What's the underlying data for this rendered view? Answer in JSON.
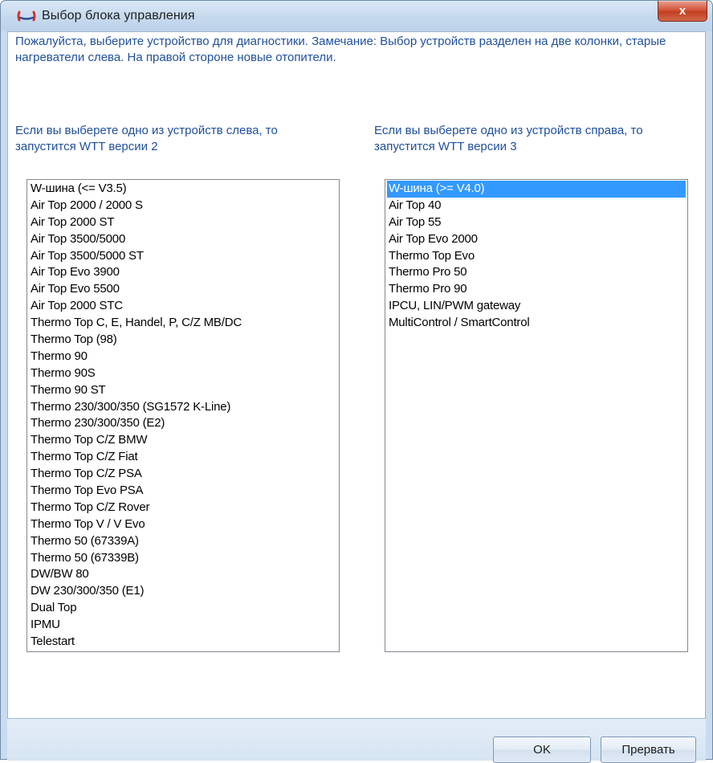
{
  "window": {
    "title": "Выбор блока управления",
    "close_label": "x"
  },
  "intro_text": "Пожалуйста, выберите устройство для диагностики. Замечание: Выбор устройств разделен на две колонки, старые нагреватели слева. На правой стороне новые отопители.",
  "left_column": {
    "hint": "Если вы выберете одно из устройств слева, то запустится WTT версии 2",
    "items": [
      "W-шина (<= V3.5)",
      "Air Top 2000 / 2000 S",
      "Air Top 2000 ST",
      "Air Top 3500/5000",
      "Air Top 3500/5000 ST",
      "Air Top Evo 3900",
      "Air Top Evo 5500",
      "Air Top 2000 STC",
      "Thermo Top C, E, Handel, P, C/Z MB/DC",
      "Thermo Top (98)",
      "Thermo 90",
      "Thermo 90S",
      "Thermo 90 ST",
      "Thermo 230/300/350 (SG1572 K-Line)",
      "Thermo 230/300/350 (E2)",
      "Thermo Top C/Z BMW",
      "Thermo Top C/Z Fiat",
      "Thermo Top C/Z PSA",
      "Thermo Top Evo PSA",
      "Thermo Top C/Z Rover",
      "Thermo Top V / V Evo",
      "Thermo 50 (67339A)",
      "Thermo 50 (67339B)",
      "DW/BW 80",
      "DW 230/300/350 (E1)",
      "Dual Top",
      "IPMU",
      "Telestart"
    ]
  },
  "right_column": {
    "hint": "Если вы выберете одно из устройств справа, то запустится WTT версии 3",
    "selected_index": 0,
    "items": [
      "W-шина (>= V4.0)",
      "Air Top 40",
      "Air Top 55",
      "Air Top Evo 2000",
      "Thermo Top Evo",
      "Thermo Pro 50",
      "Thermo Pro 90",
      "IPCU, LIN/PWM gateway",
      "MultiControl / SmartControl"
    ]
  },
  "buttons": {
    "ok": "OK",
    "cancel": "Прервать"
  },
  "colors": {
    "hint_text": "#1f4f9c",
    "selection": "#3399ff",
    "close_button": "#c23f22"
  },
  "icons": {
    "app": "heater-logo-icon",
    "close": "close-icon"
  }
}
